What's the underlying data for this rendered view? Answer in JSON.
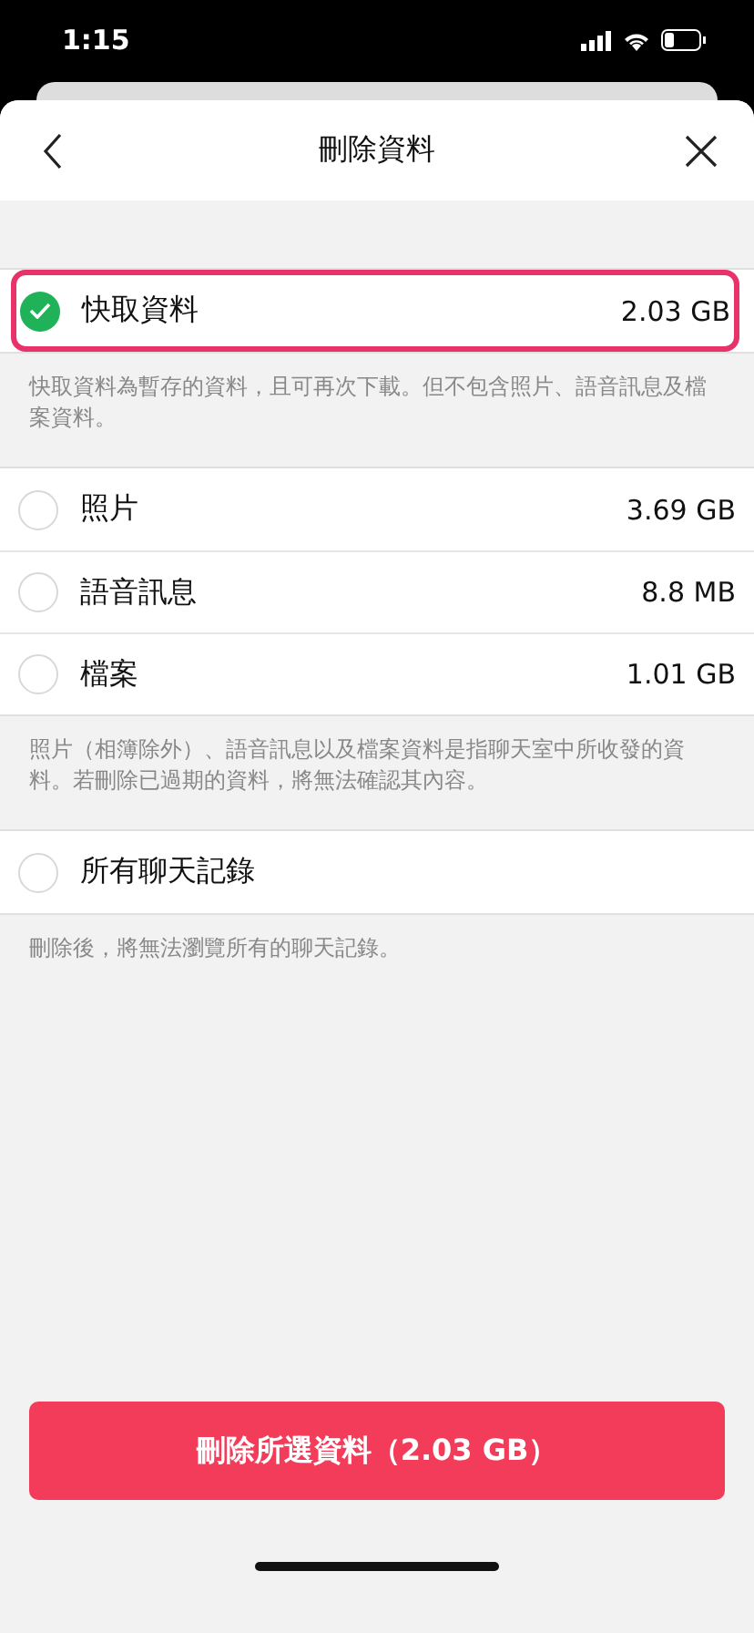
{
  "status_bar": {
    "time": "1:15"
  },
  "header": {
    "title": "刪除資料"
  },
  "sections": [
    {
      "items": [
        {
          "label": "快取資料",
          "size": "2.03 GB",
          "checked": true,
          "highlighted": true
        }
      ],
      "note": "快取資料為暫存的資料，且可再次下載。但不包含照片、語音訊息及檔案資料。"
    },
    {
      "items": [
        {
          "label": "照片",
          "size": "3.69 GB",
          "checked": false,
          "highlighted": false
        },
        {
          "label": "語音訊息",
          "size": "8.8 MB",
          "checked": false,
          "highlighted": false
        },
        {
          "label": "檔案",
          "size": "1.01 GB",
          "checked": false,
          "highlighted": false
        }
      ],
      "note": "照片（相簿除外）、語音訊息以及檔案資料是指聊天室中所收發的資料。若刪除已過期的資料，將無法確認其內容。"
    },
    {
      "items": [
        {
          "label": "所有聊天記錄",
          "checked": false,
          "highlighted": false
        }
      ],
      "note": "刪除後，將無法瀏覽所有的聊天記錄。"
    }
  ],
  "delete_button": {
    "label": "刪除所選資料（2.03 GB）"
  }
}
